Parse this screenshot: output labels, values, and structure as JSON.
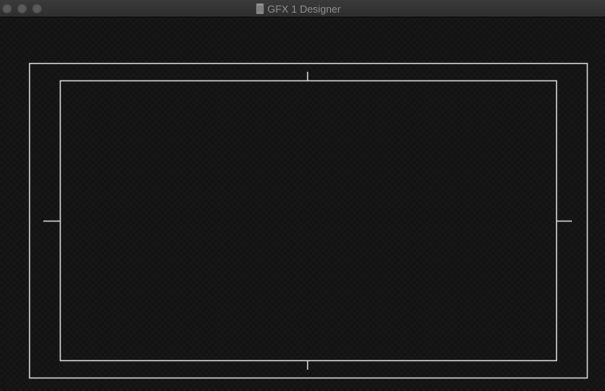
{
  "window": {
    "title": "GFX 1 Designer",
    "title_icon": "document-icon"
  },
  "canvas": {
    "background": "#131313",
    "guide_color": "#d6d6d6"
  }
}
